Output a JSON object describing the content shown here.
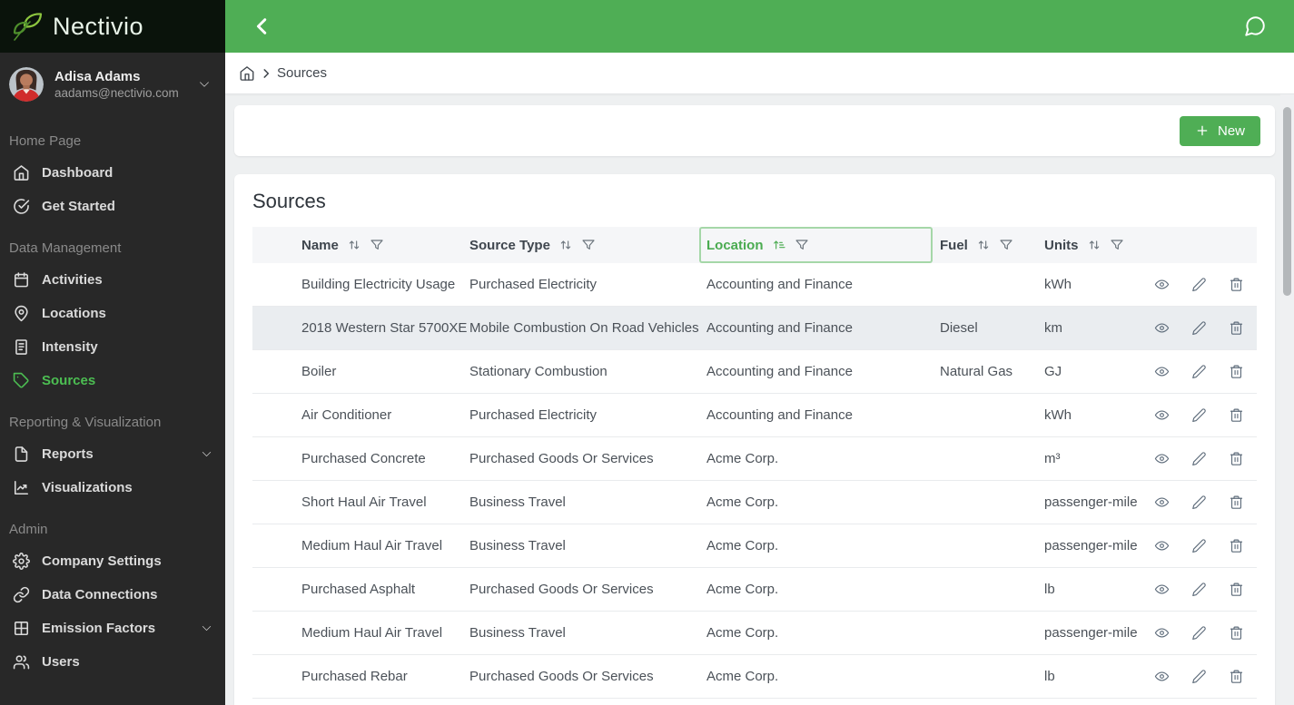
{
  "brand": {
    "name": "Nectivio",
    "logo_icon": "leaf-icon"
  },
  "user": {
    "name": "Adisa Adams",
    "email": "aadams@nectivio.com",
    "menu_icon": "chevron-down-icon"
  },
  "sidebar": {
    "sections": [
      {
        "label": "Home Page",
        "items": [
          {
            "label": "Dashboard",
            "icon": "home-icon",
            "active": false
          },
          {
            "label": "Get Started",
            "icon": "check-circle-icon",
            "active": false
          }
        ]
      },
      {
        "label": "Data Management",
        "items": [
          {
            "label": "Activities",
            "icon": "calendar-icon",
            "active": false
          },
          {
            "label": "Locations",
            "icon": "map-pin-icon",
            "active": false
          },
          {
            "label": "Intensity",
            "icon": "notebook-icon",
            "active": false
          },
          {
            "label": "Sources",
            "icon": "tag-icon",
            "active": true
          }
        ]
      },
      {
        "label": "Reporting & Visualization",
        "items": [
          {
            "label": "Reports",
            "icon": "file-icon",
            "active": false,
            "expandable": true
          },
          {
            "label": "Visualizations",
            "icon": "chart-icon",
            "active": false
          }
        ]
      },
      {
        "label": "Admin",
        "items": [
          {
            "label": "Company Settings",
            "icon": "gear-icon",
            "active": false
          },
          {
            "label": "Data Connections",
            "icon": "link-icon",
            "active": false
          },
          {
            "label": "Emission Factors",
            "icon": "grid-icon",
            "active": false,
            "expandable": true
          },
          {
            "label": "Users",
            "icon": "users-icon",
            "active": false
          }
        ]
      }
    ]
  },
  "topbar": {
    "back_icon": "chevron-left-icon",
    "chat_icon": "chat-bubble-icon"
  },
  "breadcrumb": {
    "home_icon": "home-icon",
    "current": "Sources"
  },
  "toolbar": {
    "new_button": {
      "label": "New",
      "icon": "plus-icon"
    }
  },
  "table": {
    "title": "Sources",
    "columns": [
      {
        "label": "Name",
        "sort": "none",
        "filter": true
      },
      {
        "label": "Source Type",
        "sort": "none",
        "filter": true
      },
      {
        "label": "Location",
        "sort": "asc",
        "filter": true,
        "highlighted": true
      },
      {
        "label": "Fuel",
        "sort": "none",
        "filter": true
      },
      {
        "label": "Units",
        "sort": "none",
        "filter": true
      }
    ],
    "rows": [
      {
        "name": "Building Electricity Usage",
        "source_type": "Purchased Electricity",
        "location": "Accounting and Finance",
        "fuel": "",
        "units": "kWh",
        "highlighted": false
      },
      {
        "name": "2018 Western Star 5700XE",
        "source_type": "Mobile Combustion On Road Vehicles",
        "location": "Accounting and Finance",
        "fuel": "Diesel",
        "units": "km",
        "highlighted": true
      },
      {
        "name": "Boiler",
        "source_type": "Stationary Combustion",
        "location": "Accounting and Finance",
        "fuel": "Natural Gas",
        "units": "GJ",
        "highlighted": false
      },
      {
        "name": "Air Conditioner",
        "source_type": "Purchased Electricity",
        "location": "Accounting and Finance",
        "fuel": "",
        "units": "kWh",
        "highlighted": false
      },
      {
        "name": "Purchased Concrete",
        "source_type": "Purchased Goods Or Services",
        "location": "Acme Corp.",
        "fuel": "",
        "units": "m³",
        "highlighted": false
      },
      {
        "name": "Short Haul Air Travel",
        "source_type": "Business Travel",
        "location": "Acme Corp.",
        "fuel": "",
        "units": "passenger-mile",
        "highlighted": false
      },
      {
        "name": "Medium Haul Air Travel",
        "source_type": "Business Travel",
        "location": "Acme Corp.",
        "fuel": "",
        "units": "passenger-mile",
        "highlighted": false
      },
      {
        "name": "Purchased Asphalt",
        "source_type": "Purchased Goods Or Services",
        "location": "Acme Corp.",
        "fuel": "",
        "units": "lb",
        "highlighted": false
      },
      {
        "name": "Medium Haul Air Travel",
        "source_type": "Business Travel",
        "location": "Acme Corp.",
        "fuel": "",
        "units": "passenger-mile",
        "highlighted": false
      },
      {
        "name": "Purchased Rebar",
        "source_type": "Purchased Goods Or Services",
        "location": "Acme Corp.",
        "fuel": "",
        "units": "lb",
        "highlighted": false
      }
    ],
    "row_actions": [
      {
        "name": "view",
        "icon": "eye-icon"
      },
      {
        "name": "edit",
        "icon": "pencil-icon"
      },
      {
        "name": "delete",
        "icon": "trash-icon"
      }
    ]
  },
  "colors": {
    "brand_green": "#4FAE55",
    "active_item_green": "#4CBE52",
    "sorted_column_green": "#4AAB50",
    "highlight_row": "#EAEDF0",
    "sidebar_bg": "#282828",
    "logo_bg": "#0A130B"
  }
}
